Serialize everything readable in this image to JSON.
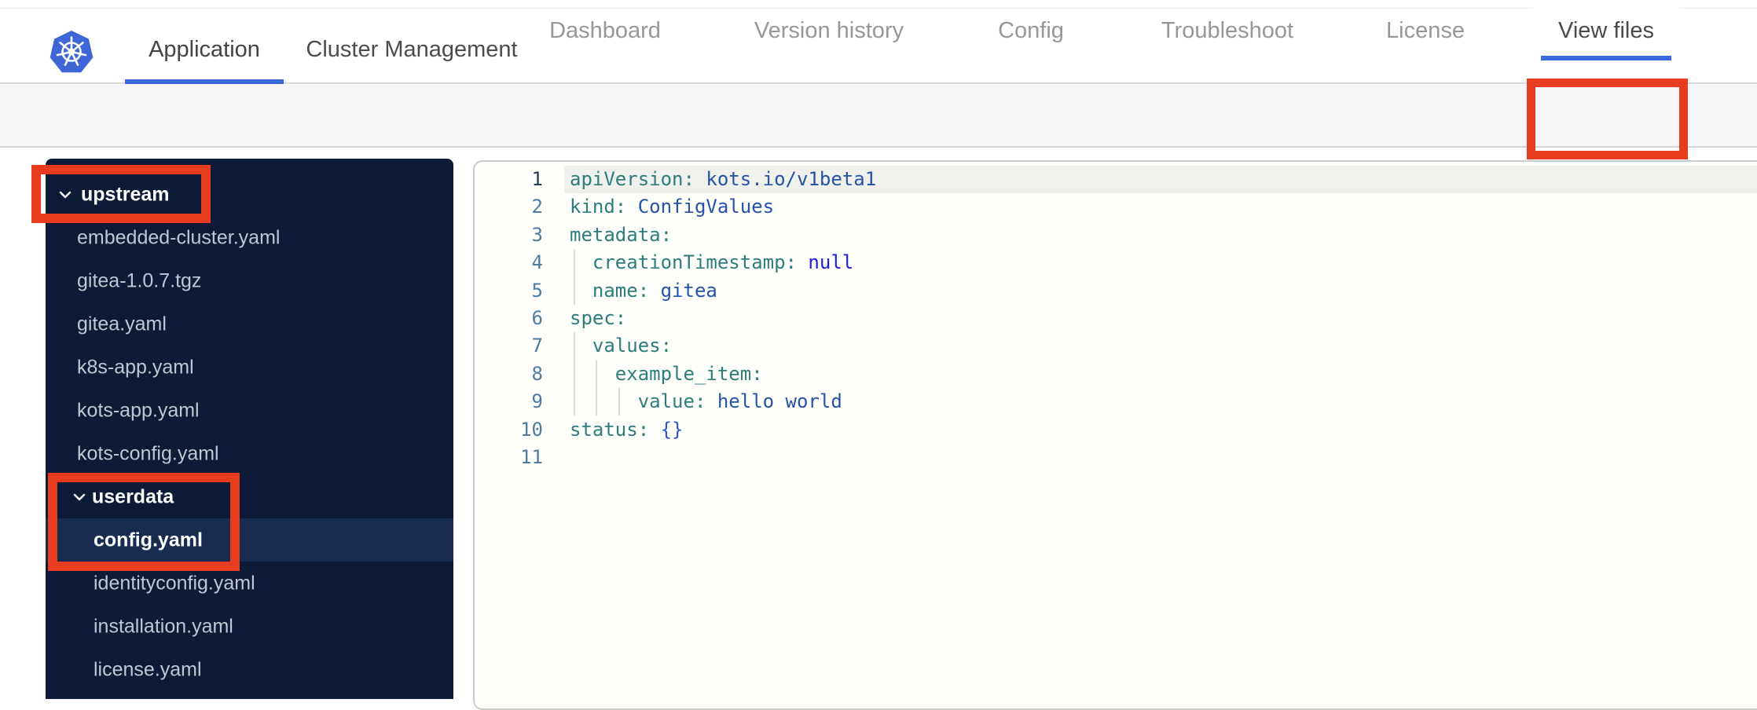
{
  "header": {
    "logo": "kubernetes-logo",
    "tabs": [
      {
        "label": "Application",
        "active": true
      },
      {
        "label": "Cluster Management",
        "active": false
      }
    ]
  },
  "subnav": {
    "tabs": [
      {
        "label": "Dashboard",
        "active": false
      },
      {
        "label": "Version history",
        "active": false
      },
      {
        "label": "Config",
        "active": false
      },
      {
        "label": "Troubleshoot",
        "active": false
      },
      {
        "label": "License",
        "active": false
      },
      {
        "label": "View files",
        "active": true
      }
    ]
  },
  "file_tree": {
    "items": [
      {
        "label": "upstream",
        "type": "folder",
        "expanded": true,
        "level": 0,
        "selected": false
      },
      {
        "label": "embedded-cluster.yaml",
        "type": "file",
        "level": 1,
        "selected": false
      },
      {
        "label": "gitea-1.0.7.tgz",
        "type": "file",
        "level": 1,
        "selected": false
      },
      {
        "label": "gitea.yaml",
        "type": "file",
        "level": 1,
        "selected": false
      },
      {
        "label": "k8s-app.yaml",
        "type": "file",
        "level": 1,
        "selected": false
      },
      {
        "label": "kots-app.yaml",
        "type": "file",
        "level": 1,
        "selected": false
      },
      {
        "label": "kots-config.yaml",
        "type": "file",
        "level": 1,
        "selected": false
      },
      {
        "label": "userdata",
        "type": "folder",
        "expanded": true,
        "level": 1,
        "selected": false
      },
      {
        "label": "config.yaml",
        "type": "file",
        "level": 2,
        "selected": true
      },
      {
        "label": "identityconfig.yaml",
        "type": "file",
        "level": 2,
        "selected": false
      },
      {
        "label": "installation.yaml",
        "type": "file",
        "level": 2,
        "selected": false
      },
      {
        "label": "license.yaml",
        "type": "file",
        "level": 2,
        "selected": false
      }
    ]
  },
  "editor": {
    "language": "yaml",
    "active_line": 1,
    "lines": [
      {
        "n": 1,
        "tokens": [
          {
            "c": "key",
            "t": "apiVersion:"
          },
          {
            "c": "val",
            "t": " kots.io/v1beta1"
          }
        ]
      },
      {
        "n": 2,
        "tokens": [
          {
            "c": "key",
            "t": "kind:"
          },
          {
            "c": "val",
            "t": " ConfigValues"
          }
        ]
      },
      {
        "n": 3,
        "tokens": [
          {
            "c": "key",
            "t": "metadata:"
          }
        ]
      },
      {
        "n": 4,
        "tokens": [
          {
            "c": "key",
            "t": "  creationTimestamp:"
          },
          {
            "c": "kw",
            "t": " null"
          }
        ]
      },
      {
        "n": 5,
        "tokens": [
          {
            "c": "key",
            "t": "  name:"
          },
          {
            "c": "val",
            "t": " gitea"
          }
        ]
      },
      {
        "n": 6,
        "tokens": [
          {
            "c": "key",
            "t": "spec:"
          }
        ]
      },
      {
        "n": 7,
        "tokens": [
          {
            "c": "key",
            "t": "  values:"
          }
        ]
      },
      {
        "n": 8,
        "tokens": [
          {
            "c": "key",
            "t": "    example_item:"
          }
        ]
      },
      {
        "n": 9,
        "tokens": [
          {
            "c": "key",
            "t": "      value:"
          },
          {
            "c": "val",
            "t": " hello world"
          }
        ]
      },
      {
        "n": 10,
        "tokens": [
          {
            "c": "key",
            "t": "status:"
          },
          {
            "c": "brace",
            "t": " {}"
          }
        ]
      },
      {
        "n": 11,
        "tokens": []
      }
    ]
  },
  "annotations": {
    "color": "#e73c1e",
    "boxes": [
      {
        "target": "upstream-folder"
      },
      {
        "target": "userdata-config-file"
      },
      {
        "target": "view-files-tab"
      }
    ]
  },
  "colors": {
    "accent_blue": "#3a68df",
    "kubernetes_blue": "#3e66d6",
    "sidebar_bg": "#0e1b38",
    "sidebar_selected_bg": "#172c4f",
    "annotation_red": "#e73c1e",
    "yaml_key": "#2e7d7d",
    "yaml_value": "#2553a8",
    "yaml_keyword": "#1d1de8",
    "yaml_braces": "#2e54cc"
  }
}
